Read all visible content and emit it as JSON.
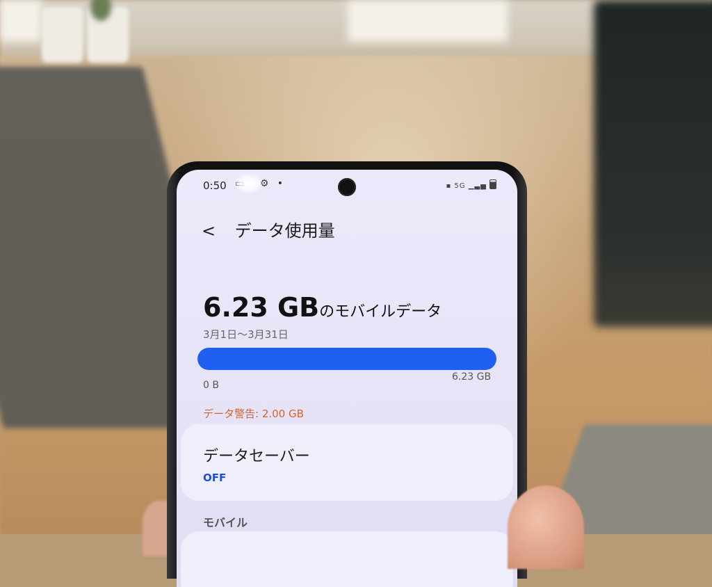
{
  "status_bar": {
    "time": "0:50",
    "right_icons": "5G"
  },
  "header": {
    "back_symbol": "<",
    "title": "データ使用量"
  },
  "usage": {
    "amount": "6.23 GB",
    "suffix": "のモバイルデータ",
    "period": "3月1日～3月31日",
    "progress_fraction": 1.0,
    "bar_min_label": "0 B",
    "bar_max_label": "6.23 GB"
  },
  "warning": "データ警告: 2.00 GB",
  "data_saver": {
    "title": "データセーバー",
    "state": "OFF"
  },
  "mobile_section": {
    "label": "モバイル"
  },
  "colors": {
    "accent": "#1f5ff2",
    "warning": "#d06430",
    "state": "#1f4fd8"
  }
}
